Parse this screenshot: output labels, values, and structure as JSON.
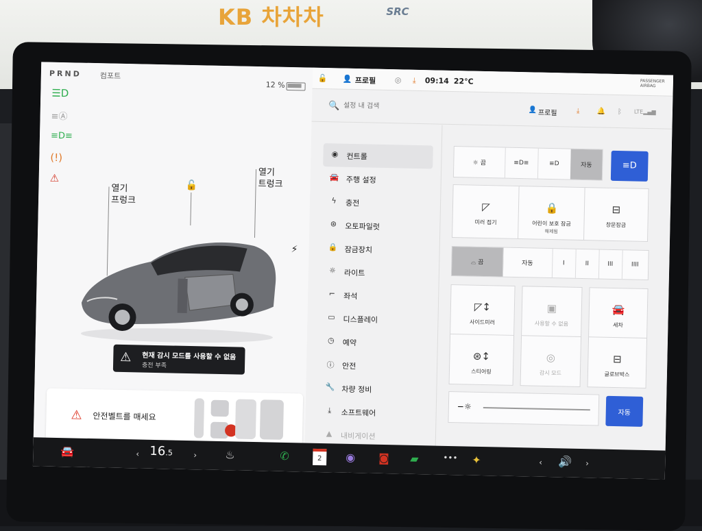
{
  "environment": {
    "brand": "KB 차차차",
    "brand_logo_right": "SRC"
  },
  "status": {
    "gear": "PRND",
    "drive_mode": "컴포트",
    "battery_percent": "12 %",
    "profile": "프로필",
    "time": "09:14",
    "temperature": "22°C",
    "passenger_airbag": "PASSENGER AIRBAG"
  },
  "left_panel": {
    "frunk_label_line1": "열기",
    "frunk_label_line2": "프렁크",
    "trunk_label_line1": "열기",
    "trunk_label_line2": "트렁크",
    "alert_title": "현재 감시 모드를 사용할 수 없음",
    "alert_subtitle": "충전 부족",
    "seatbelt_message": "안전벨트를 매세요"
  },
  "search": {
    "placeholder": "설정 내 검색",
    "profile_label": "프로필"
  },
  "nav": {
    "items": [
      {
        "label": "컨트롤",
        "icon": "toggle-icon"
      },
      {
        "label": "주행 설정",
        "icon": "car-icon"
      },
      {
        "label": "충전",
        "icon": "bolt-icon"
      },
      {
        "label": "오토파일럿",
        "icon": "steering-wheel-icon"
      },
      {
        "label": "잠금장치",
        "icon": "lock-icon"
      },
      {
        "label": "라이트",
        "icon": "sun-icon"
      },
      {
        "label": "좌석",
        "icon": "seat-icon"
      },
      {
        "label": "디스플레이",
        "icon": "display-icon"
      },
      {
        "label": "예약",
        "icon": "clock-icon"
      },
      {
        "label": "안전",
        "icon": "info-icon"
      },
      {
        "label": "차량 정비",
        "icon": "wrench-icon"
      },
      {
        "label": "소프트웨어",
        "icon": "download-icon"
      },
      {
        "label": "내비게이션",
        "icon": "navigation-icon"
      }
    ]
  },
  "controls": {
    "lights": {
      "segments": [
        "끔",
        "",
        "",
        "자동"
      ],
      "selected": "자동"
    },
    "quick_cards": [
      {
        "label": "미러 접기",
        "sub": ""
      },
      {
        "label": "어린이 보호 잠금",
        "sub": "해제됨"
      },
      {
        "label": "창문잠금",
        "sub": ""
      }
    ],
    "wipers": {
      "segments": [
        "끔",
        "자동",
        "I",
        "II",
        "III",
        "IIII"
      ],
      "selected": "끔"
    },
    "grid_cards": [
      {
        "label": "사이드미러",
        "dim": false
      },
      {
        "label": "사용할 수 없음",
        "dim": true
      },
      {
        "label": "세차",
        "dim": false
      },
      {
        "label": "스티어링",
        "dim": false
      },
      {
        "label": "감시 모드",
        "dim": true
      },
      {
        "label": "글로브박스",
        "dim": false
      }
    ],
    "brightness_auto": "자동"
  },
  "dock": {
    "temperature": "16",
    "temperature_decimal": ".5",
    "calendar_day": "2"
  },
  "colors": {
    "accent_blue": "#2f5fd6",
    "alert_dark": "#1d1e21",
    "warning_red": "#d33322",
    "indicator_green": "#2fae4f"
  }
}
